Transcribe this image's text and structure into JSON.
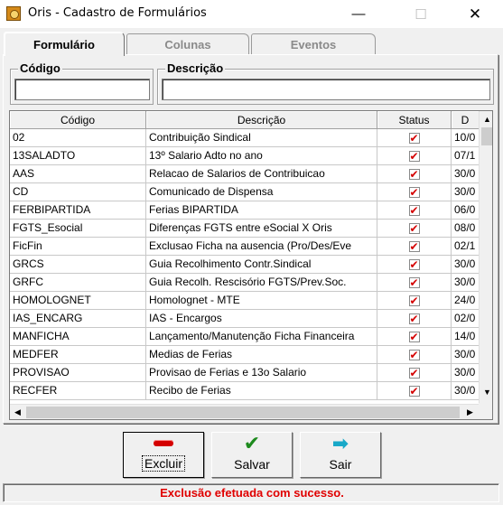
{
  "window": {
    "title": "Oris - Cadastro de Formulários",
    "minimize_glyph": "—",
    "maximize_glyph": "☐",
    "close_glyph": "✕"
  },
  "tabs": [
    {
      "label": "Formulário",
      "active": true
    },
    {
      "label": "Colunas",
      "active": false
    },
    {
      "label": "Eventos",
      "active": false
    }
  ],
  "filters": {
    "codigo": {
      "label": "Código",
      "value": ""
    },
    "descricao": {
      "label": "Descrição",
      "value": ""
    }
  },
  "grid": {
    "columns": [
      "Código",
      "Descrição",
      "Status",
      "D"
    ],
    "rows": [
      {
        "codigo": "02",
        "descricao": "Contribuição Sindical",
        "status": true,
        "d": "10/0"
      },
      {
        "codigo": "13SALADTO",
        "descricao": "13º Salario Adto no ano",
        "status": true,
        "d": "07/1"
      },
      {
        "codigo": "AAS",
        "descricao": "Relacao de Salarios de Contribuicao",
        "status": true,
        "d": "30/0"
      },
      {
        "codigo": "CD",
        "descricao": "Comunicado de Dispensa",
        "status": true,
        "d": "30/0"
      },
      {
        "codigo": "FERBIPARTIDA",
        "descricao": "Ferias BIPARTIDA",
        "status": true,
        "d": "06/0"
      },
      {
        "codigo": "FGTS_Esocial",
        "descricao": "Diferenças FGTS entre eSocial X Oris",
        "status": true,
        "d": "08/0"
      },
      {
        "codigo": "FicFin",
        "descricao": "Exclusao Ficha na ausencia (Pro/Des/Eve",
        "status": true,
        "d": "02/1"
      },
      {
        "codigo": "GRCS",
        "descricao": "Guia Recolhimento Contr.Sindical",
        "status": true,
        "d": "30/0"
      },
      {
        "codigo": "GRFC",
        "descricao": "Guia Recolh. Rescisório FGTS/Prev.Soc.",
        "status": true,
        "d": "30/0"
      },
      {
        "codigo": "HOMOLOGNET",
        "descricao": "Homolognet - MTE",
        "status": true,
        "d": "24/0"
      },
      {
        "codigo": "IAS_ENCARG",
        "descricao": "IAS - Encargos",
        "status": true,
        "d": "02/0"
      },
      {
        "codigo": "MANFICHA",
        "descricao": "Lançamento/Manutenção Ficha Financeira",
        "status": true,
        "d": "14/0"
      },
      {
        "codigo": "MEDFER",
        "descricao": "Medias de Ferias",
        "status": true,
        "d": "30/0"
      },
      {
        "codigo": "PROVISAO",
        "descricao": "Provisao de Ferias e 13o Salario",
        "status": true,
        "d": "30/0"
      },
      {
        "codigo": "RECFER",
        "descricao": "Recibo de Ferias",
        "status": true,
        "d": "30/0"
      }
    ]
  },
  "scroll": {
    "up": "▲",
    "down": "▼",
    "left": "◀",
    "right": "▶"
  },
  "buttons": {
    "excluir": "Excluir",
    "salvar": "Salvar",
    "sair": "Sair"
  },
  "icons": {
    "excluir": "minus-icon",
    "salvar": "check-icon",
    "sair": "arrow-right-icon"
  },
  "colors": {
    "status_message": "#e00000",
    "check_mark": "#d40000"
  },
  "status_bar": {
    "message": "Exclusão efetuada com sucesso."
  }
}
